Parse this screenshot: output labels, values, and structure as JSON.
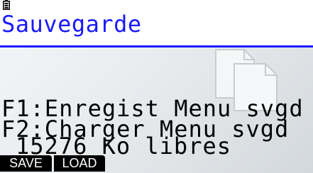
{
  "status_bar": {
    "icon": "battery-icon"
  },
  "header": {
    "title": "Sauvegarde"
  },
  "body": {
    "line1": "F1:Enregist Menu svgd",
    "line2": "F2:Charger Menu svgd",
    "line3": "15276 Ko libres"
  },
  "function_keys": {
    "f1": "SAVE",
    "f2": "LOAD"
  },
  "colors": {
    "title": "#1a1aff",
    "fkey_bg": "#000000",
    "fkey_text": "#ffffff"
  },
  "background_icon": "document-copy-icon"
}
